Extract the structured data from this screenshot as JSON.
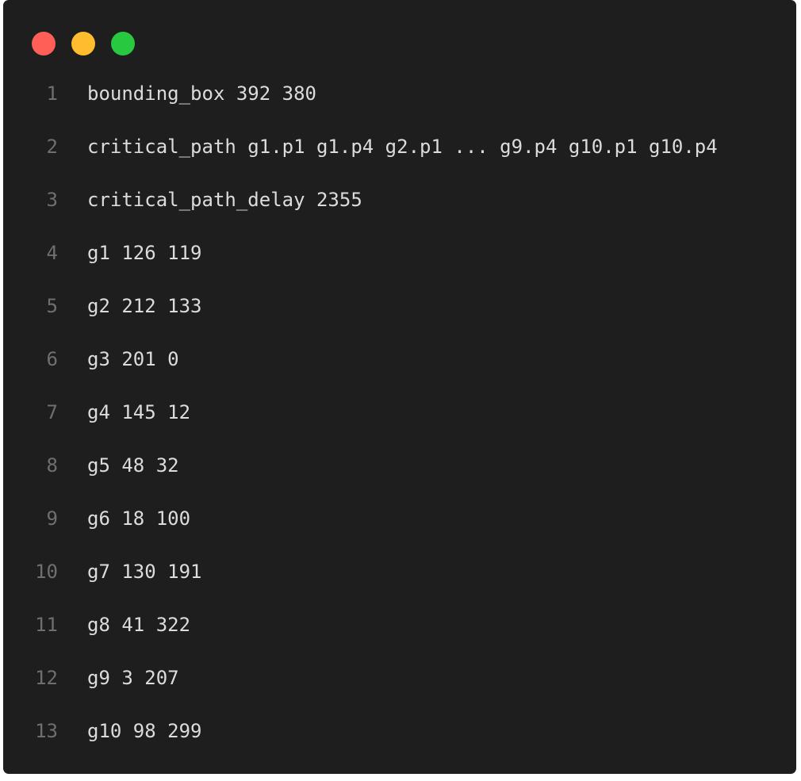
{
  "window": {
    "buttons": [
      {
        "name": "close",
        "color": "#ff5f57"
      },
      {
        "name": "minimize",
        "color": "#febc2e"
      },
      {
        "name": "maximize",
        "color": "#28c840"
      }
    ]
  },
  "code": {
    "lines": [
      {
        "num": "1",
        "text": "bounding_box 392 380"
      },
      {
        "num": "2",
        "text": "critical_path g1.p1 g1.p4 g2.p1 ... g9.p4 g10.p1 g10.p4"
      },
      {
        "num": "3",
        "text": "critical_path_delay 2355"
      },
      {
        "num": "4",
        "text": "g1 126 119"
      },
      {
        "num": "5",
        "text": "g2 212 133"
      },
      {
        "num": "6",
        "text": "g3 201 0"
      },
      {
        "num": "7",
        "text": "g4 145 12"
      },
      {
        "num": "8",
        "text": "g5 48 32"
      },
      {
        "num": "9",
        "text": "g6 18 100"
      },
      {
        "num": "10",
        "text": "g7 130 191"
      },
      {
        "num": "11",
        "text": "g8 41 322"
      },
      {
        "num": "12",
        "text": "g9 3 207"
      },
      {
        "num": "13",
        "text": "g10 98 299"
      }
    ]
  },
  "colors": {
    "background": "#1e1e1e",
    "text": "#dcdcdc",
    "line_number": "#6f6f6f"
  }
}
